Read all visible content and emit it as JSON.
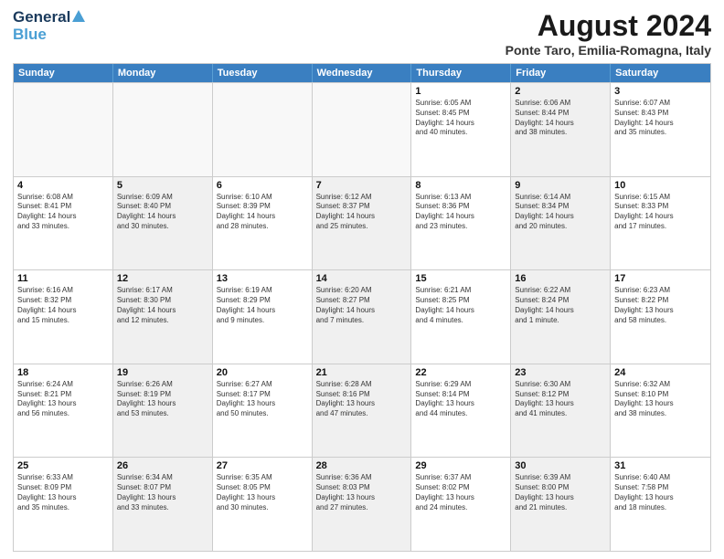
{
  "header": {
    "logo_line1": "General",
    "logo_line2": "Blue",
    "main_title": "August 2024",
    "subtitle": "Ponte Taro, Emilia-Romagna, Italy"
  },
  "weekdays": [
    "Sunday",
    "Monday",
    "Tuesday",
    "Wednesday",
    "Thursday",
    "Friday",
    "Saturday"
  ],
  "rows": [
    [
      {
        "day": "",
        "info": "",
        "empty": true
      },
      {
        "day": "",
        "info": "",
        "empty": true
      },
      {
        "day": "",
        "info": "",
        "empty": true
      },
      {
        "day": "",
        "info": "",
        "empty": true
      },
      {
        "day": "1",
        "info": "Sunrise: 6:05 AM\nSunset: 8:45 PM\nDaylight: 14 hours\nand 40 minutes."
      },
      {
        "day": "2",
        "info": "Sunrise: 6:06 AM\nSunset: 8:44 PM\nDaylight: 14 hours\nand 38 minutes."
      },
      {
        "day": "3",
        "info": "Sunrise: 6:07 AM\nSunset: 8:43 PM\nDaylight: 14 hours\nand 35 minutes."
      }
    ],
    [
      {
        "day": "4",
        "info": "Sunrise: 6:08 AM\nSunset: 8:41 PM\nDaylight: 14 hours\nand 33 minutes."
      },
      {
        "day": "5",
        "info": "Sunrise: 6:09 AM\nSunset: 8:40 PM\nDaylight: 14 hours\nand 30 minutes."
      },
      {
        "day": "6",
        "info": "Sunrise: 6:10 AM\nSunset: 8:39 PM\nDaylight: 14 hours\nand 28 minutes."
      },
      {
        "day": "7",
        "info": "Sunrise: 6:12 AM\nSunset: 8:37 PM\nDaylight: 14 hours\nand 25 minutes."
      },
      {
        "day": "8",
        "info": "Sunrise: 6:13 AM\nSunset: 8:36 PM\nDaylight: 14 hours\nand 23 minutes."
      },
      {
        "day": "9",
        "info": "Sunrise: 6:14 AM\nSunset: 8:34 PM\nDaylight: 14 hours\nand 20 minutes."
      },
      {
        "day": "10",
        "info": "Sunrise: 6:15 AM\nSunset: 8:33 PM\nDaylight: 14 hours\nand 17 minutes."
      }
    ],
    [
      {
        "day": "11",
        "info": "Sunrise: 6:16 AM\nSunset: 8:32 PM\nDaylight: 14 hours\nand 15 minutes."
      },
      {
        "day": "12",
        "info": "Sunrise: 6:17 AM\nSunset: 8:30 PM\nDaylight: 14 hours\nand 12 minutes."
      },
      {
        "day": "13",
        "info": "Sunrise: 6:19 AM\nSunset: 8:29 PM\nDaylight: 14 hours\nand 9 minutes."
      },
      {
        "day": "14",
        "info": "Sunrise: 6:20 AM\nSunset: 8:27 PM\nDaylight: 14 hours\nand 7 minutes."
      },
      {
        "day": "15",
        "info": "Sunrise: 6:21 AM\nSunset: 8:25 PM\nDaylight: 14 hours\nand 4 minutes."
      },
      {
        "day": "16",
        "info": "Sunrise: 6:22 AM\nSunset: 8:24 PM\nDaylight: 14 hours\nand 1 minute."
      },
      {
        "day": "17",
        "info": "Sunrise: 6:23 AM\nSunset: 8:22 PM\nDaylight: 13 hours\nand 58 minutes."
      }
    ],
    [
      {
        "day": "18",
        "info": "Sunrise: 6:24 AM\nSunset: 8:21 PM\nDaylight: 13 hours\nand 56 minutes."
      },
      {
        "day": "19",
        "info": "Sunrise: 6:26 AM\nSunset: 8:19 PM\nDaylight: 13 hours\nand 53 minutes."
      },
      {
        "day": "20",
        "info": "Sunrise: 6:27 AM\nSunset: 8:17 PM\nDaylight: 13 hours\nand 50 minutes."
      },
      {
        "day": "21",
        "info": "Sunrise: 6:28 AM\nSunset: 8:16 PM\nDaylight: 13 hours\nand 47 minutes."
      },
      {
        "day": "22",
        "info": "Sunrise: 6:29 AM\nSunset: 8:14 PM\nDaylight: 13 hours\nand 44 minutes."
      },
      {
        "day": "23",
        "info": "Sunrise: 6:30 AM\nSunset: 8:12 PM\nDaylight: 13 hours\nand 41 minutes."
      },
      {
        "day": "24",
        "info": "Sunrise: 6:32 AM\nSunset: 8:10 PM\nDaylight: 13 hours\nand 38 minutes."
      }
    ],
    [
      {
        "day": "25",
        "info": "Sunrise: 6:33 AM\nSunset: 8:09 PM\nDaylight: 13 hours\nand 35 minutes."
      },
      {
        "day": "26",
        "info": "Sunrise: 6:34 AM\nSunset: 8:07 PM\nDaylight: 13 hours\nand 33 minutes."
      },
      {
        "day": "27",
        "info": "Sunrise: 6:35 AM\nSunset: 8:05 PM\nDaylight: 13 hours\nand 30 minutes."
      },
      {
        "day": "28",
        "info": "Sunrise: 6:36 AM\nSunset: 8:03 PM\nDaylight: 13 hours\nand 27 minutes."
      },
      {
        "day": "29",
        "info": "Sunrise: 6:37 AM\nSunset: 8:02 PM\nDaylight: 13 hours\nand 24 minutes."
      },
      {
        "day": "30",
        "info": "Sunrise: 6:39 AM\nSunset: 8:00 PM\nDaylight: 13 hours\nand 21 minutes."
      },
      {
        "day": "31",
        "info": "Sunrise: 6:40 AM\nSunset: 7:58 PM\nDaylight: 13 hours\nand 18 minutes."
      }
    ]
  ]
}
